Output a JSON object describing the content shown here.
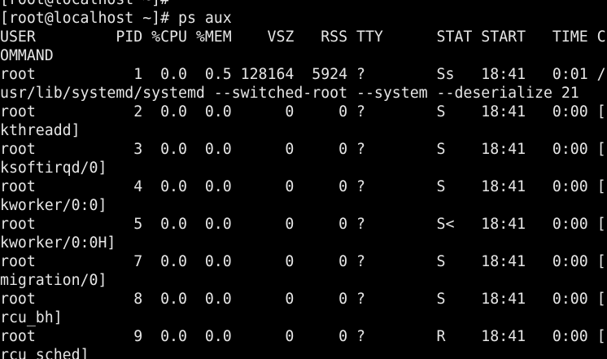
{
  "terminal": {
    "lines": [
      "[root@localhost ~]#",
      "[root@localhost ~]# ps aux",
      "USER         PID %CPU %MEM    VSZ   RSS TTY      STAT START   TIME C",
      "OMMAND",
      "root           1  0.0  0.5 128164  5924 ?        Ss   18:41   0:01 /",
      "usr/lib/systemd/systemd --switched-root --system --deserialize 21",
      "root           2  0.0  0.0      0     0 ?        S    18:41   0:00 [",
      "kthreadd]",
      "root           3  0.0  0.0      0     0 ?        S    18:41   0:00 [",
      "ksoftirqd/0]",
      "root           4  0.0  0.0      0     0 ?        S    18:41   0:00 [",
      "kworker/0:0]",
      "root           5  0.0  0.0      0     0 ?        S<   18:41   0:00 [",
      "kworker/0:0H]",
      "root           7  0.0  0.0      0     0 ?        S    18:41   0:00 [",
      "migration/0]",
      "root           8  0.0  0.0      0     0 ?        S    18:41   0:00 [",
      "rcu_bh]",
      "root           9  0.0  0.0      0     0 ?        R    18:41   0:00 [",
      "rcu_sched]"
    ]
  }
}
